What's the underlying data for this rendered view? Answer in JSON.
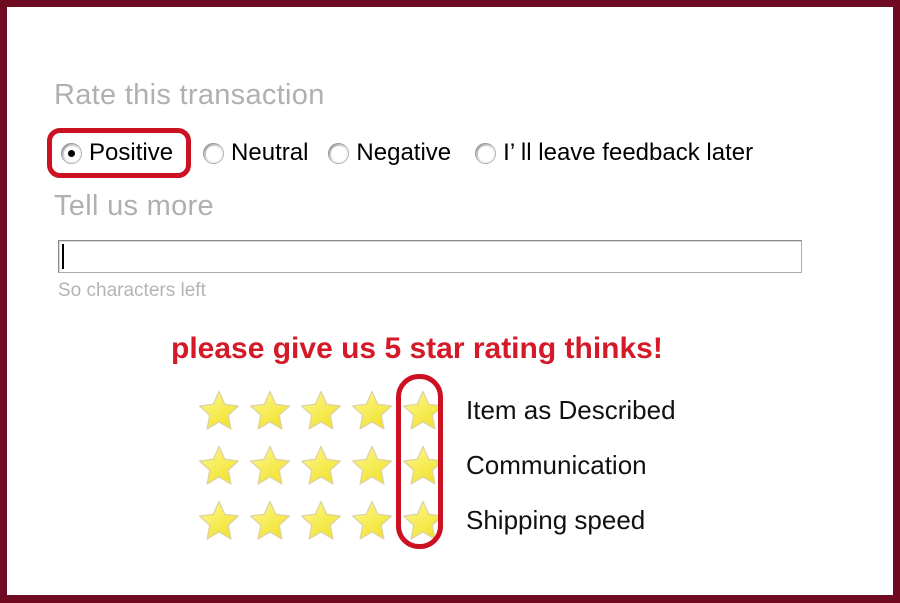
{
  "border": {
    "color": "#6e0a22"
  },
  "rate_section": {
    "heading": "Rate this transaction",
    "options": [
      {
        "label": "Positive",
        "selected": true,
        "icon": "radio-button-selected-icon"
      },
      {
        "label": "Neutral",
        "selected": false,
        "icon": "radio-button-icon"
      },
      {
        "label": "Negative",
        "selected": false,
        "icon": "radio-button-icon"
      },
      {
        "label": "I’ ll leave feedback later",
        "selected": false,
        "icon": "radio-button-icon"
      }
    ],
    "highlight_color": "#cc1122"
  },
  "tell_section": {
    "heading": "Tell us more",
    "input_value": "",
    "input_placeholder": "",
    "chars_left": "So characters left"
  },
  "promo": {
    "message": "please give us 5 star rating thinks!",
    "color": "#d41a28"
  },
  "ratings": {
    "star_count": 5,
    "highlight_column": 5,
    "highlight_color": "#cc1122",
    "rows": [
      {
        "label": "Item as Described",
        "value": 5
      },
      {
        "label": "Communication",
        "value": 5
      },
      {
        "label": "Shipping speed",
        "value": 5
      }
    ]
  }
}
